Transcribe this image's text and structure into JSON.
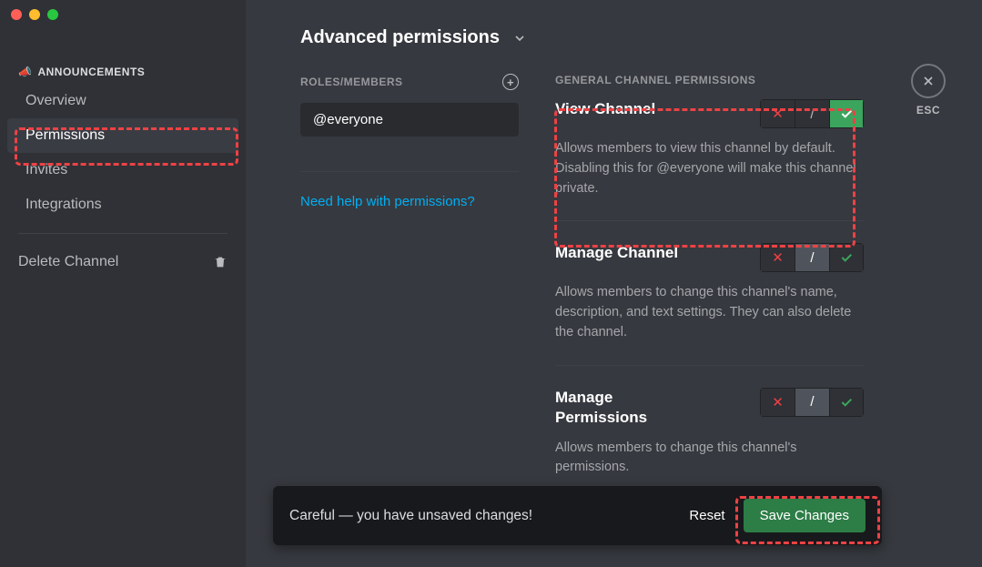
{
  "sidebar": {
    "heading": "ANNOUNCEMENTS",
    "items": [
      {
        "label": "Overview"
      },
      {
        "label": "Permissions"
      },
      {
        "label": "Invites"
      },
      {
        "label": "Integrations"
      }
    ],
    "delete_label": "Delete Channel"
  },
  "page": {
    "title": "Advanced permissions"
  },
  "roles": {
    "heading": "ROLES/MEMBERS",
    "current": "@everyone",
    "help_link": "Need help with permissions?"
  },
  "perms_heading": "GENERAL CHANNEL PERMISSIONS",
  "perms": [
    {
      "title": "View Channel",
      "desc": "Allows members to view this channel by default. Disabling this for @everyone will make this channel private.",
      "state": "allow"
    },
    {
      "title": "Manage Channel",
      "desc": "Allows members to change this channel's name, description, and text settings. They can also delete the channel.",
      "state": "neutral"
    },
    {
      "title": "Manage Permissions",
      "desc": "Allows members to change this channel's permissions.",
      "state": "neutral"
    }
  ],
  "unsaved": {
    "message": "Careful — you have unsaved changes!",
    "reset": "Reset",
    "save": "Save Changes"
  },
  "esc": {
    "label": "ESC"
  }
}
